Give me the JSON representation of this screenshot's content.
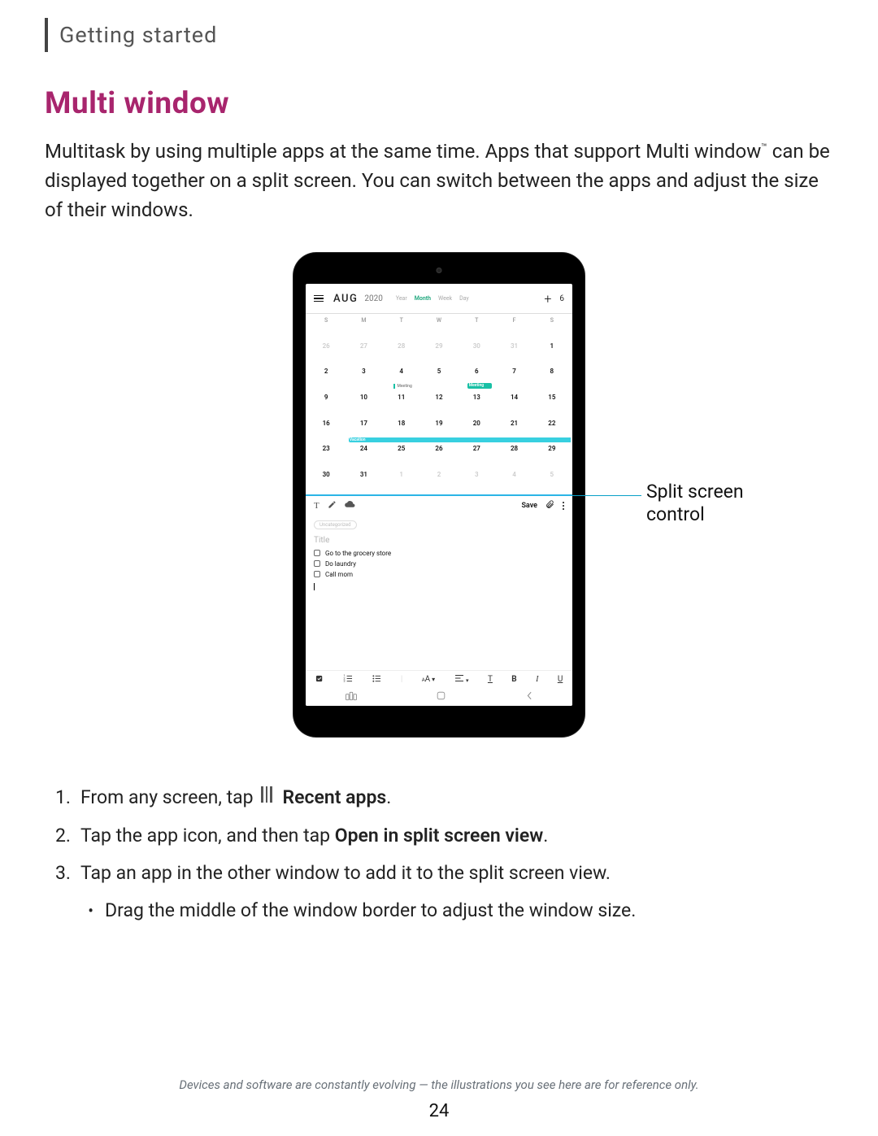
{
  "header": "Getting started",
  "title": "Multi window",
  "intro_html": "Multitask by using multiple apps at the same time. Apps that support Multi window<sup>™</sup> can be displayed together on a split screen. You can switch between the apps and adjust the size of their windows.",
  "figure": {
    "callout_label": "Split screen control",
    "calendar": {
      "month": "AUG",
      "year": "2020",
      "views": {
        "year": "Year",
        "month": "Month",
        "week": "Week",
        "day": "Day"
      },
      "today_icon": "6",
      "day_headers": [
        "S",
        "M",
        "T",
        "W",
        "T",
        "F",
        "S"
      ],
      "rows": [
        {
          "cells": [
            "26",
            "27",
            "28",
            "29",
            "30",
            "31",
            "1"
          ],
          "dim": [
            0,
            1,
            2,
            3,
            4,
            5
          ]
        },
        {
          "cells": [
            "2",
            "3",
            "4",
            "5",
            "6",
            "7",
            "8"
          ],
          "meeting_at": 2,
          "meeting_label": "Meeting",
          "green_block_at": 4,
          "green_block_label": "Meeting"
        },
        {
          "cells": [
            "9",
            "10",
            "11",
            "12",
            "13",
            "14",
            "15"
          ]
        },
        {
          "cells": [
            "16",
            "17",
            "18",
            "19",
            "20",
            "21",
            "22"
          ],
          "bar": true,
          "bar_start": 1,
          "bar_label": "Vacation"
        },
        {
          "cells": [
            "23",
            "24",
            "25",
            "26",
            "27",
            "28",
            "29"
          ]
        },
        {
          "cells": [
            "30",
            "31",
            "1",
            "2",
            "3",
            "4",
            "5"
          ],
          "dim": [
            2,
            3,
            4,
            5,
            6
          ]
        }
      ]
    },
    "notes": {
      "save": "Save",
      "tag": "Uncategorized",
      "title_placeholder": "Title",
      "items": [
        "Go to the grocery store",
        "Do laundry",
        "Call mom"
      ],
      "toolbar": {
        "bold": "B",
        "italic": "I",
        "underline": "U"
      }
    }
  },
  "steps": [
    {
      "n": "1.",
      "pre": "From any screen, tap",
      "icon": "recent-apps-icon",
      "post_bold": "Recent apps",
      "suffix": "."
    },
    {
      "n": "2.",
      "text_parts": [
        "Tap the app icon, and then tap ",
        "Open in split screen view",
        "."
      ]
    },
    {
      "n": "3.",
      "text": "Tap an app in the other window to add it to the split screen view."
    }
  ],
  "sub_bullet": "Drag the middle of the window border to adjust the window size.",
  "footer_note": "Devices and software are constantly evolving — the illustrations you see here are for reference only.",
  "page_number": "24"
}
